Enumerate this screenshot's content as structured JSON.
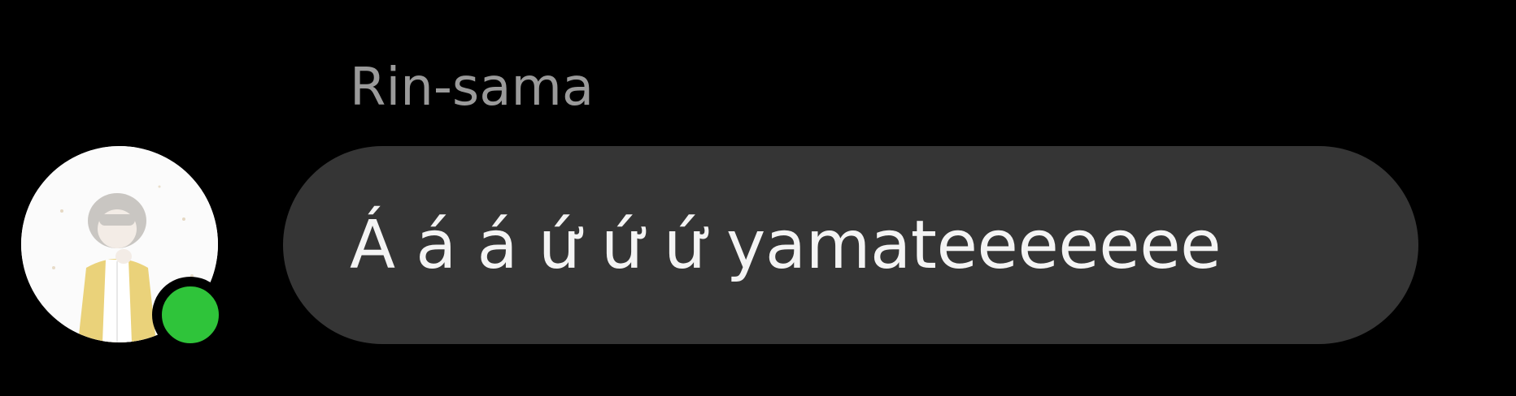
{
  "message": {
    "sender_name": "Rin-sama",
    "text": "Á á á ứ ứ ứ yamateeeeeee",
    "bubble_color": "#353535",
    "text_color": "#f4f4f4"
  },
  "avatar": {
    "presence": "online",
    "presence_color": "#2fc43a"
  }
}
